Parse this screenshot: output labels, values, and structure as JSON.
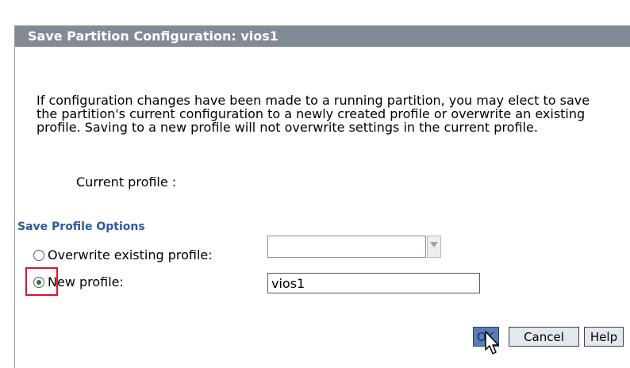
{
  "dialog": {
    "title": "Save Partition Configuration: vios1",
    "description": "If configuration changes have been made to a running partition, you may elect to save the partition's current configuration to a newly created profile or overwrite an existing profile. Saving to a new profile will not overwrite settings in the current profile.",
    "current_profile_label": "Current profile :"
  },
  "save_options": {
    "heading": "Save Profile Options",
    "overwrite_label": "Overwrite existing profile:",
    "overwrite_selected": false,
    "existing_profile_value": "",
    "new_profile_label": "New profile:",
    "new_profile_selected": true,
    "new_profile_value": "vios1"
  },
  "buttons": {
    "ok": "OK",
    "cancel": "Cancel",
    "help": "Help"
  },
  "colors": {
    "title_bar": "#828a96",
    "section_heading": "#2d5a9c",
    "highlight": "#e0102a",
    "ok_button": "#5a7cb8"
  },
  "icons": {
    "select_arrow": "chevron-down-icon",
    "cursor": "mouse-pointer-icon"
  }
}
